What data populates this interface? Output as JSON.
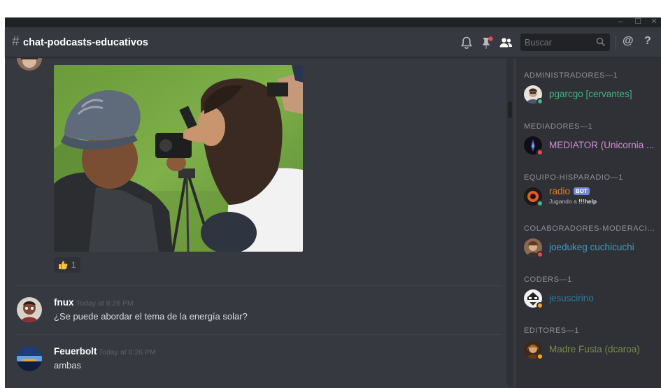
{
  "window": {
    "minimize_glyph": "–",
    "maximize_glyph": "☐",
    "close_glyph": "✕"
  },
  "header": {
    "hash": "#",
    "channel_name": "chat-podcasts-educativos",
    "search_placeholder": "Buscar",
    "mention_label": "@",
    "help_label": "?"
  },
  "messages": {
    "reaction": {
      "icon": "thumbs-up-icon",
      "count": "1"
    },
    "items": [
      {
        "author": "fnux",
        "timestamp": "Today at 8:26 PM",
        "text": "¿Se puede abordar el tema de la energía solar?"
      },
      {
        "author": "Feuerbolt",
        "timestamp": "Today at 8:26 PM",
        "text": "ambas"
      }
    ]
  },
  "members": {
    "groups": [
      {
        "label": "ADMINISTRADORES—1",
        "members": [
          {
            "name": "pgarcgo [cervantes]",
            "color": "#43b581",
            "status": "online"
          }
        ]
      },
      {
        "label": "MEDIADORES—1",
        "members": [
          {
            "name": "MEDIATOR (Unicornia ...",
            "color": "#d38ed8",
            "status": "dnd"
          }
        ]
      },
      {
        "label": "EQUIPO-HISPARADIO—1",
        "members": [
          {
            "name": "radio",
            "color": "#e67e22",
            "status": "online",
            "tag": "BOT",
            "activity_prefix": "Jugando a ",
            "activity_game": "!!!help"
          }
        ]
      },
      {
        "label": "COLABORADORES-MODERACIÓN...",
        "members": [
          {
            "name": "joedukeg cuchicuchi",
            "color": "#3d9dc7",
            "status": "dnd"
          }
        ]
      },
      {
        "label": "CODERS—1",
        "members": [
          {
            "name": "jesuscirino",
            "color": "#2a7d9c",
            "status": "idle"
          }
        ]
      },
      {
        "label": "EDITORES—1",
        "members": [
          {
            "name": "Madre Fusta (dcaroa)",
            "color": "#7a8a4a",
            "status": "idle"
          }
        ]
      }
    ]
  },
  "colors": {
    "background": "#36393f",
    "sidebar": "#2f3136",
    "online": "#43b581",
    "idle": "#faa61a",
    "dnd": "#f04747"
  }
}
